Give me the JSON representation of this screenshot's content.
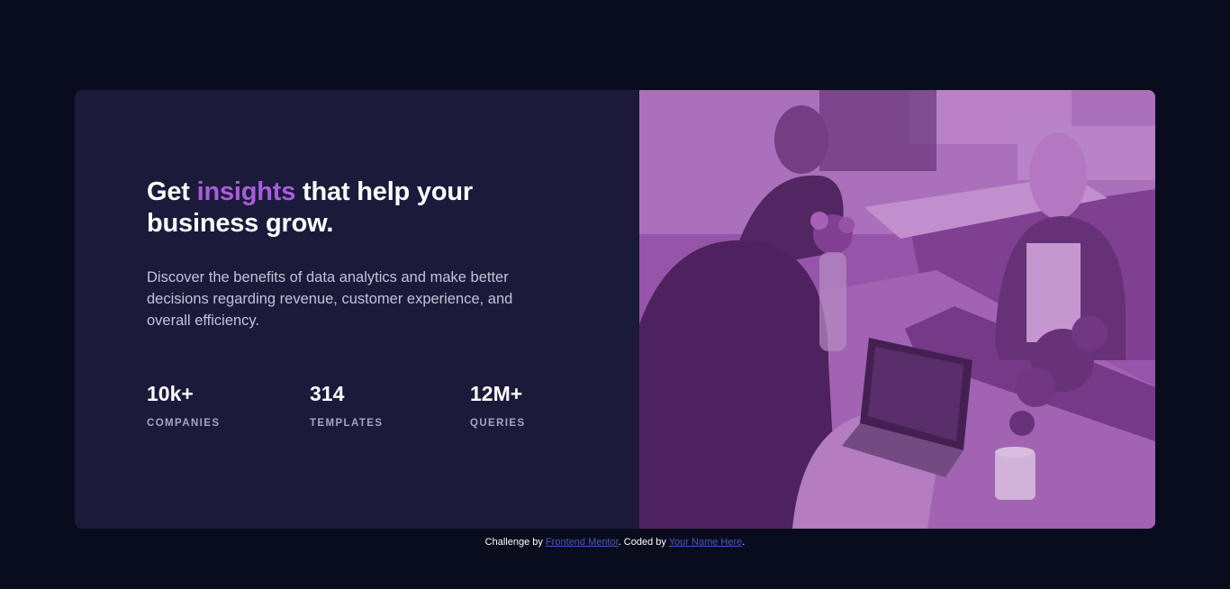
{
  "hero": {
    "headline_part1": "Get ",
    "headline_accent": "insights",
    "headline_part2": " that help your business grow.",
    "description": "Discover the benefits of data analytics and make better decisions regarding revenue, customer experience, and overall efficiency."
  },
  "stats": [
    {
      "value": "10k+",
      "label": "COMPANIES"
    },
    {
      "value": "314",
      "label": "TEMPLATES"
    },
    {
      "value": "12M+",
      "label": "QUERIES"
    }
  ],
  "footer": {
    "prefix": "Challenge by ",
    "link1": "Frontend Mentor",
    "middle": ". Coded by ",
    "link2": "Your Name Here",
    "suffix": "."
  },
  "colors": {
    "background": "#090c1d",
    "card": "#1b1a3b",
    "accent": "#aa5cdb",
    "photo_overlay": "#8d4aa0"
  }
}
